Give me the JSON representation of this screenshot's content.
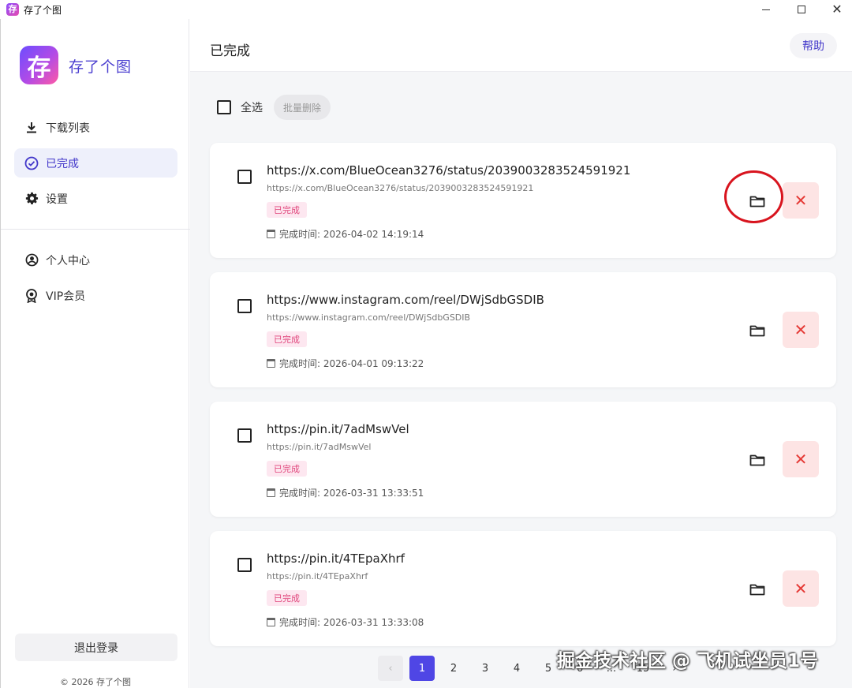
{
  "window": {
    "title": "存了个图",
    "icon_text": "存"
  },
  "sidebar": {
    "brand": "存了个图",
    "logo_text": "存",
    "items": [
      {
        "label": "下载列表",
        "icon": "download-icon"
      },
      {
        "label": "已完成",
        "icon": "check-circle-icon",
        "active": true
      },
      {
        "label": "设置",
        "icon": "gear-icon"
      },
      {
        "label": "个人中心",
        "icon": "user-circle-icon"
      },
      {
        "label": "VIP会员",
        "icon": "badge-icon"
      }
    ],
    "logout_label": "退出登录",
    "copyright": "© 2026 存了个图"
  },
  "header": {
    "title": "已完成",
    "help_label": "帮助"
  },
  "toolbar": {
    "select_all_label": "全选",
    "batch_delete_label": "批量删除"
  },
  "items": [
    {
      "title": "https://x.com/BlueOcean3276/status/2039003283524591921",
      "url": "https://x.com/BlueOcean3276/status/2039003283524591921",
      "status": "已完成",
      "time": "完成时间: 2026-04-02 14:19:14"
    },
    {
      "title": "https://www.instagram.com/reel/DWjSdbGSDIB",
      "url": "https://www.instagram.com/reel/DWjSdbGSDIB",
      "status": "已完成",
      "time": "完成时间: 2026-04-01 09:13:22"
    },
    {
      "title": "https://pin.it/7adMswVel",
      "url": "https://pin.it/7adMswVel",
      "status": "已完成",
      "time": "完成时间: 2026-03-31 13:33:51"
    },
    {
      "title": "https://pin.it/4TEpaXhrf",
      "url": "https://pin.it/4TEpaXhrf",
      "status": "已完成",
      "time": "完成时间: 2026-03-31 13:33:08"
    }
  ],
  "pagination": {
    "pages": [
      "1",
      "2",
      "3",
      "4",
      "5",
      "6",
      "...",
      "15"
    ],
    "current": "1"
  },
  "watermark": "掘金技术社区 @ 飞机试坐员1号",
  "colors": {
    "accent": "#4f46e5",
    "status_badge_bg": "#fde7f0",
    "status_badge_text": "#e0457b",
    "delete_bg": "#fde4e4",
    "delete_icon": "#e53935",
    "annotation": "#d8141e"
  }
}
